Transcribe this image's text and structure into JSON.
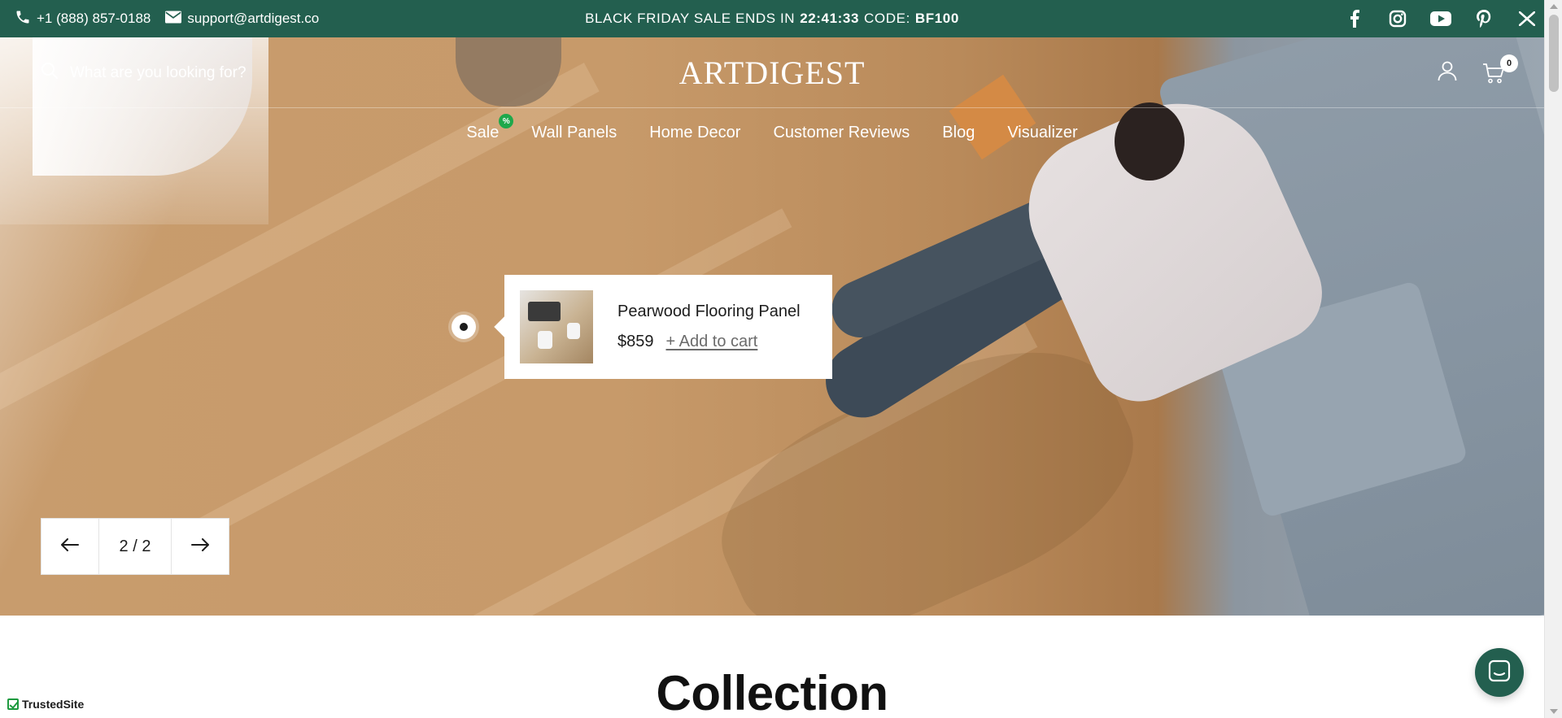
{
  "announcement": {
    "phone": "+1 (888) 857-0188",
    "email": "support@artdigest.co",
    "promo_prefix": "BLACK FRIDAY SALE ENDS IN",
    "countdown": "22:41:33",
    "code_label": "CODE:",
    "code": "BF100",
    "social": [
      "facebook-icon",
      "instagram-icon",
      "youtube-icon",
      "pinterest-icon",
      "x-icon"
    ]
  },
  "header": {
    "search_placeholder": "What are you looking for?",
    "logo": "ARTDIGEST",
    "cart_count": "0"
  },
  "nav": {
    "items": [
      {
        "label": "Sale",
        "badge": "%"
      },
      {
        "label": "Wall Panels"
      },
      {
        "label": "Home Decor"
      },
      {
        "label": "Customer Reviews"
      },
      {
        "label": "Blog"
      },
      {
        "label": "Visualizer"
      }
    ]
  },
  "hotspot_product": {
    "name": "Pearwood Flooring Panel",
    "price": "$859",
    "add_to_cart": "+ Add to cart"
  },
  "slider": {
    "counter": "2 / 2"
  },
  "collection": {
    "title": "Collection"
  },
  "badges": {
    "trusted_site": "TrustedSite"
  },
  "colors": {
    "brand_green": "#235f4f",
    "sale_badge": "#1ea84b"
  }
}
